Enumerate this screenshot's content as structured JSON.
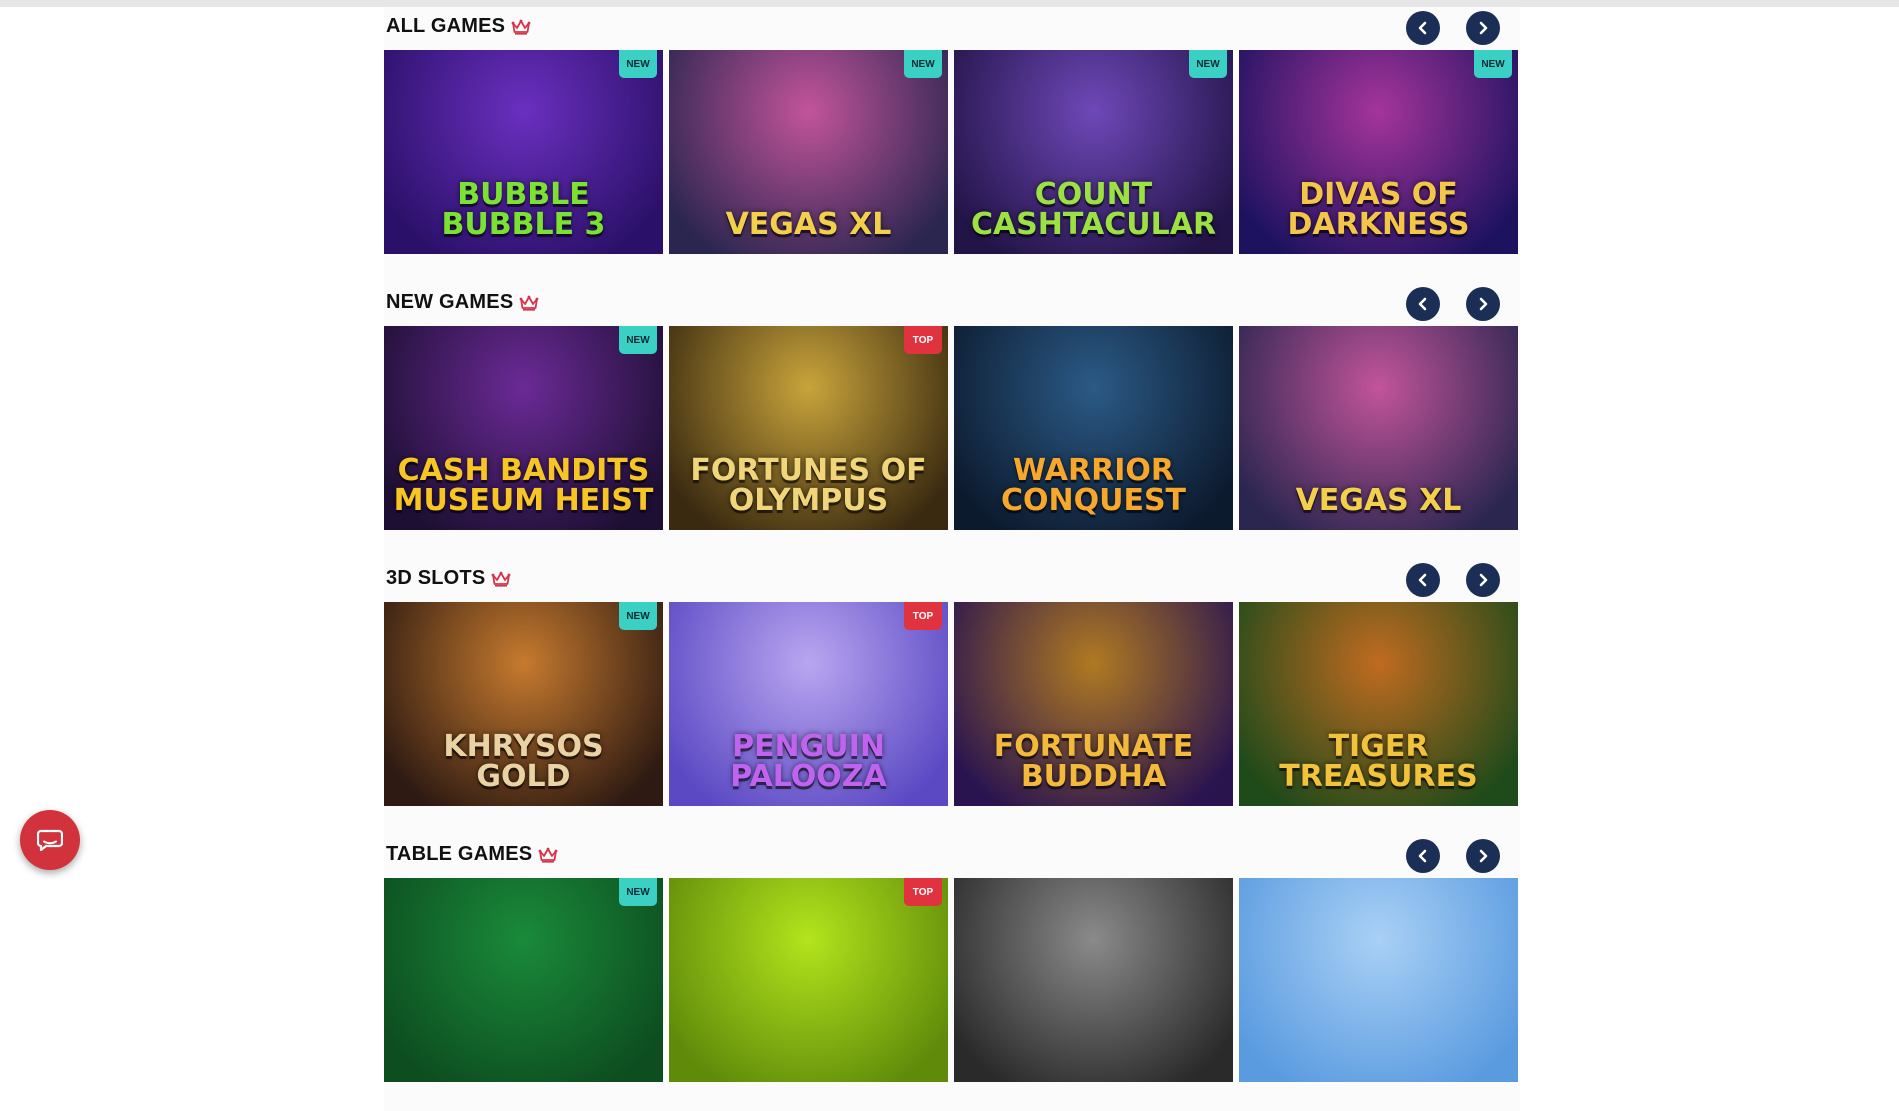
{
  "chat": {
    "icon": "chat-bubble-icon"
  },
  "sections": [
    {
      "title": "ALL GAMES",
      "games": [
        {
          "name": "BUBBLE BUBBLE 3",
          "badge": "NEW",
          "badge_type": "new",
          "bg_from": "#6a2fbf",
          "bg_to": "#2a1068",
          "text_color": "#7be233"
        },
        {
          "name": "VEGAS XL",
          "badge": "NEW",
          "badge_type": "new",
          "bg_from": "#c2549a",
          "bg_to": "#2b2650",
          "text_color": "#f2d04b"
        },
        {
          "name": "COUNT CASHTACULAR",
          "badge": "NEW",
          "badge_type": "new",
          "bg_from": "#6e48b8",
          "bg_to": "#231448",
          "text_color": "#9ce144"
        },
        {
          "name": "DIVAS OF DARKNESS",
          "badge": "NEW",
          "badge_type": "new",
          "bg_from": "#a5349b",
          "bg_to": "#1d1260",
          "text_color": "#f3c649"
        }
      ]
    },
    {
      "title": "NEW GAMES",
      "games": [
        {
          "name": "CASH BANDITS MUSEUM HEIST",
          "badge": "NEW",
          "badge_type": "new",
          "bg_from": "#6b2a96",
          "bg_to": "#1d0f33",
          "text_color": "#f7c624"
        },
        {
          "name": "FORTUNES OF OLYMPUS",
          "badge": "TOP",
          "badge_type": "top",
          "bg_from": "#c9a43b",
          "bg_to": "#3a2a10",
          "text_color": "#f0d57a"
        },
        {
          "name": "WARRIOR CONQUEST",
          "badge": "",
          "badge_type": "",
          "bg_from": "#2b5a86",
          "bg_to": "#0c1a2e",
          "text_color": "#f7a72c"
        },
        {
          "name": "VEGAS XL",
          "badge": "",
          "badge_type": "",
          "bg_from": "#c2549a",
          "bg_to": "#2b2650",
          "text_color": "#f2d04b"
        }
      ]
    },
    {
      "title": "3D SLOTS",
      "games": [
        {
          "name": "KHRYSOS GOLD",
          "badge": "NEW",
          "badge_type": "new",
          "bg_from": "#c67a2e",
          "bg_to": "#2e1a12",
          "text_color": "#e9d3a5"
        },
        {
          "name": "PENGUIN PALOOZA",
          "badge": "TOP",
          "badge_type": "top",
          "bg_from": "#b9a6f0",
          "bg_to": "#5b49c4",
          "text_color": "#c064f0"
        },
        {
          "name": "FORTUNATE BUDDHA",
          "badge": "",
          "badge_type": "",
          "bg_from": "#b07a21",
          "bg_to": "#2a1450",
          "text_color": "#f2b93a"
        },
        {
          "name": "TIGER TREASURES",
          "badge": "",
          "badge_type": "",
          "bg_from": "#c06b20",
          "bg_to": "#1f4a1a",
          "text_color": "#f1c23a"
        }
      ]
    },
    {
      "title": "TABLE GAMES",
      "games": [
        {
          "name": "",
          "badge": "NEW",
          "badge_type": "new",
          "bg_from": "#1a8a3a",
          "bg_to": "#0d4d20",
          "text_color": "#ffffff"
        },
        {
          "name": "",
          "badge": "TOP",
          "badge_type": "top",
          "bg_from": "#b3e41c",
          "bg_to": "#5f8a0a",
          "text_color": "#ffffff"
        },
        {
          "name": "",
          "badge": "",
          "badge_type": "",
          "bg_from": "#8a8a8a",
          "bg_to": "#2a2a2a",
          "text_color": "#ffffff"
        },
        {
          "name": "",
          "badge": "",
          "badge_type": "",
          "bg_from": "#a9d0f5",
          "bg_to": "#5a9be0",
          "text_color": "#ffffff"
        }
      ]
    }
  ],
  "colors": {
    "nav_button": "#1b2e55",
    "new_badge": "#3ad1c4",
    "top_badge": "#e0323f",
    "crown": "#d8324a",
    "chat_button": "#d2323b"
  }
}
